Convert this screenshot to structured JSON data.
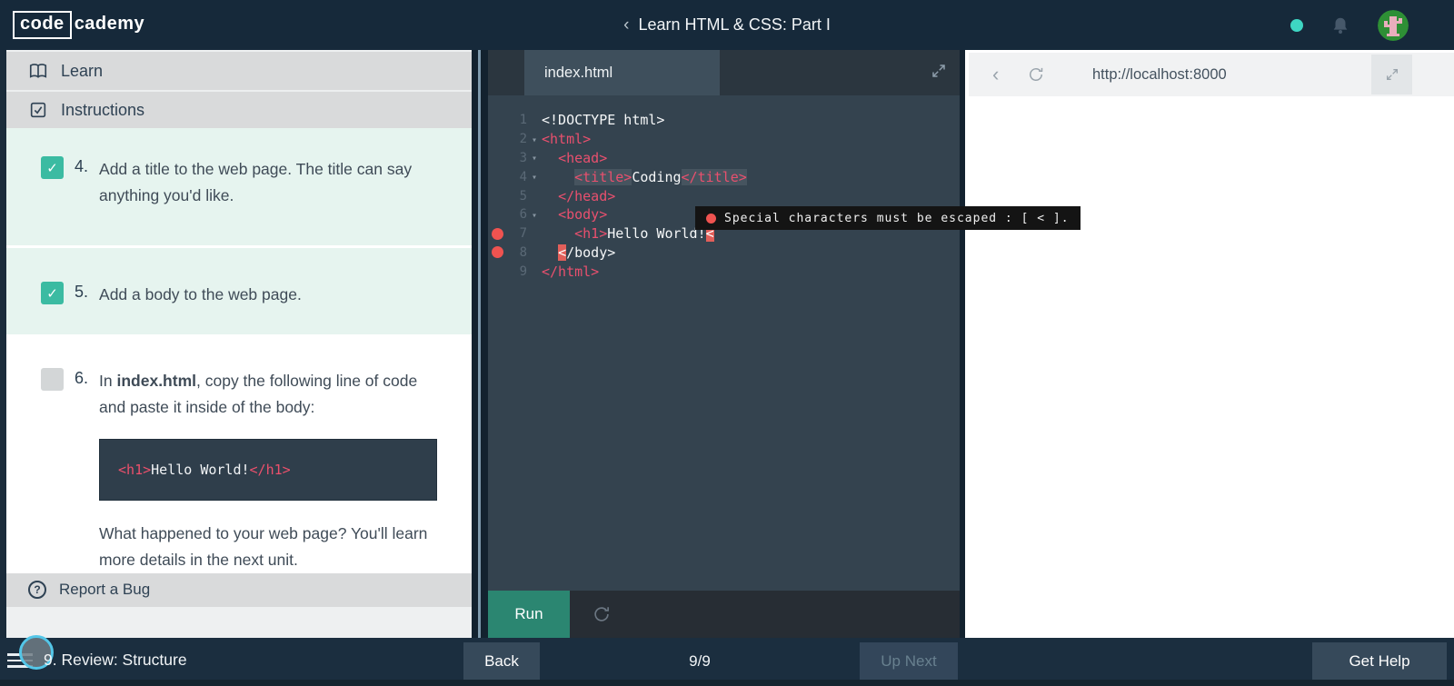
{
  "topbar": {
    "logo_code": "code",
    "logo_cademy": "cademy",
    "back_chevron": "‹",
    "title": "Learn HTML & CSS: Part I"
  },
  "sidebar": {
    "learn_label": "Learn",
    "instructions_label": "Instructions",
    "report_bug_label": "Report a Bug",
    "question_glyph": "?",
    "check_glyph": "✓",
    "steps": [
      {
        "num": "4.",
        "checked": true,
        "text": "Add a title to the web page. The title can say anything you'd like."
      },
      {
        "num": "5.",
        "checked": true,
        "text": "Add a body to the web page."
      },
      {
        "num": "6.",
        "checked": false,
        "text_prefix": "In ",
        "text_bold": "index.html",
        "text_suffix": ", copy the following line of code and paste it inside of the body:",
        "code_open": "<h1>",
        "code_text": "Hello World!",
        "code_close": "</h1>",
        "after_text": "What happened to your web page? You'll learn more details in the next unit."
      }
    ]
  },
  "editor": {
    "tab": "index.html",
    "run_label": "Run",
    "tooltip": "Special characters must be escaped : [ < ].",
    "lines": [
      {
        "num": "1",
        "fold": false,
        "error": false,
        "tokens": [
          {
            "c": "plain",
            "s": "<!DOCTYPE html>"
          }
        ]
      },
      {
        "num": "2",
        "fold": true,
        "error": false,
        "tokens": [
          {
            "c": "tag",
            "s": "<html>"
          }
        ]
      },
      {
        "num": "3",
        "fold": true,
        "error": false,
        "tokens": [
          {
            "c": "plain",
            "s": "  "
          },
          {
            "c": "tag",
            "s": "<head>"
          }
        ]
      },
      {
        "num": "4",
        "fold": true,
        "error": false,
        "tokens": [
          {
            "c": "plain",
            "s": "    "
          },
          {
            "c": "hltag",
            "s": "<title>"
          },
          {
            "c": "plain",
            "s": "Coding"
          },
          {
            "c": "hltag",
            "s": "</title>"
          }
        ]
      },
      {
        "num": "5",
        "fold": false,
        "error": false,
        "tokens": [
          {
            "c": "plain",
            "s": "  "
          },
          {
            "c": "tag",
            "s": "</head>"
          }
        ]
      },
      {
        "num": "6",
        "fold": true,
        "error": false,
        "tokens": [
          {
            "c": "plain",
            "s": "  "
          },
          {
            "c": "tag",
            "s": "<body>"
          }
        ]
      },
      {
        "num": "7",
        "fold": false,
        "error": true,
        "tokens": [
          {
            "c": "plain",
            "s": "    "
          },
          {
            "c": "tag",
            "s": "<h1>"
          },
          {
            "c": "plain",
            "s": "Hello World!"
          },
          {
            "c": "err",
            "s": "<"
          }
        ]
      },
      {
        "num": "8",
        "fold": false,
        "error": true,
        "tokens": [
          {
            "c": "plain",
            "s": "  "
          },
          {
            "c": "err",
            "s": "<"
          },
          {
            "c": "plain",
            "s": "/body>"
          }
        ]
      },
      {
        "num": "9",
        "fold": false,
        "error": false,
        "tokens": [
          {
            "c": "tag",
            "s": "</html>"
          }
        ]
      }
    ]
  },
  "browser": {
    "url": "http://localhost:8000"
  },
  "bottombar": {
    "lesson": "9. Review: Structure",
    "back": "Back",
    "progress": "9/9",
    "up_next": "Up Next",
    "get_help": "Get Help"
  },
  "colors": {
    "accent_teal": "#3bbba2",
    "code_pink": "#e9506e",
    "error_red": "#ef5350",
    "navy": "#16293a"
  }
}
